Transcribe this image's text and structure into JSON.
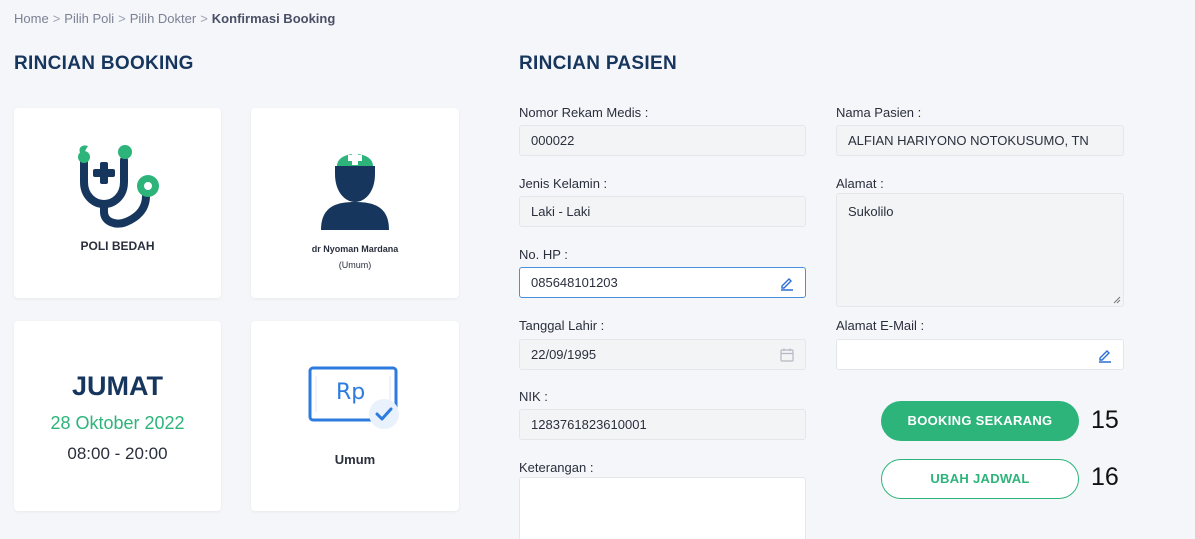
{
  "breadcrumb": {
    "items": [
      "Home",
      "Pilih Poli",
      "Pilih Dokter"
    ],
    "current": "Konfirmasi Booking",
    "separator": ">"
  },
  "booking": {
    "title": "RINCIAN BOOKING",
    "poli_label": "POLI BEDAH",
    "doctor_name": "dr Nyoman Mardana",
    "doctor_type": "(Umum)",
    "day": "JUMAT",
    "date": "28 Oktober 2022",
    "time": "08:00 - 20:00",
    "payment_symbol": "Rp",
    "payment_label": "Umum"
  },
  "patient": {
    "title": "RINCIAN PASIEN",
    "fields": {
      "rm_label": "Nomor Rekam Medis :",
      "rm_value": "000022",
      "name_label": "Nama Pasien :",
      "name_value": "ALFIAN HARIYONO NOTOKUSUMO, TN",
      "gender_label": "Jenis Kelamin :",
      "gender_value": "Laki - Laki",
      "address_label": "Alamat :",
      "address_value": "Sukolilo",
      "phone_label": "No. HP :",
      "phone_value": "085648101203",
      "dob_label": "Tanggal Lahir :",
      "dob_value": "22/09/1995",
      "email_label": "Alamat E-Mail :",
      "email_value": "",
      "nik_label": "NIK :",
      "nik_value": "1283761823610001",
      "note_label": "Keterangan :",
      "note_value": ""
    }
  },
  "actions": {
    "book_label": "BOOKING SEKARANG",
    "book_number": "15",
    "reschedule_label": "UBAH JADWAL",
    "reschedule_number": "16"
  },
  "colors": {
    "accent_green": "#2db47b",
    "title_navy": "#17365d",
    "icon_blue": "#2d7be0"
  },
  "icons": {
    "poli": "stethoscope-icon",
    "doctor": "doctor-avatar-icon",
    "payment": "money-check-icon",
    "edit": "pencil-icon",
    "calendar": "calendar-icon"
  }
}
